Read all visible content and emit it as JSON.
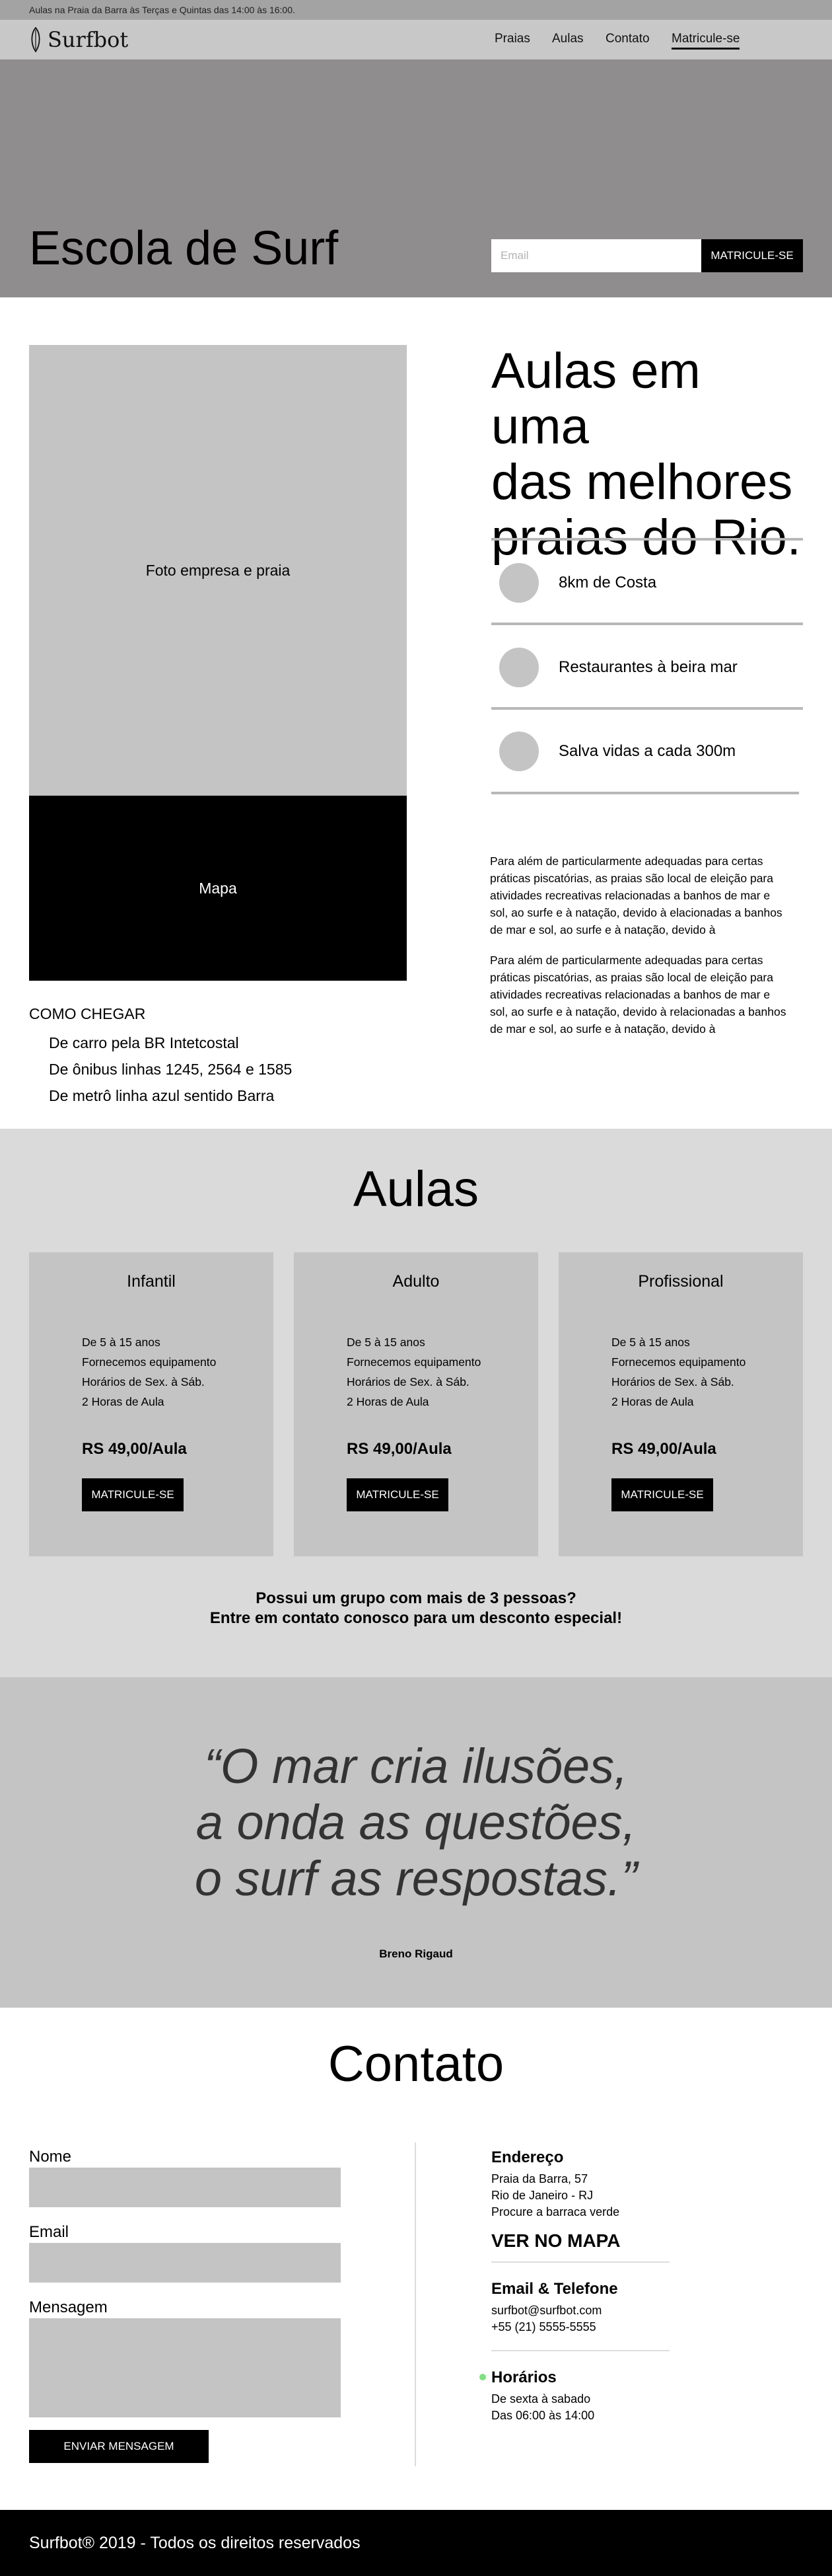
{
  "topbar": {
    "text": "Aulas na Praia da Barra às Terças e Quintas das 14:00 às 16:00."
  },
  "nav": {
    "logo": "Surfbot",
    "logo_icon": "surfboard-icon",
    "items": [
      {
        "label": "Praias"
      },
      {
        "label": "Aulas"
      },
      {
        "label": "Contato"
      },
      {
        "label": "Matricule-se",
        "active": true
      }
    ]
  },
  "hero": {
    "title": "Escola de Surf",
    "email_placeholder": "Email",
    "button": "MATRICULE-SE"
  },
  "about": {
    "photo_label": "Foto empresa e praia",
    "map_label": "Mapa",
    "how_title": "COMO CHEGAR",
    "how_items": [
      "De carro pela BR Intetcostal",
      "De ônibus linhas 1245, 2564 e 1585",
      "De metrô linha azul sentido Barra"
    ],
    "title_lines": [
      "Aulas em uma",
      "das melhores",
      "praias do Rio."
    ],
    "features": [
      {
        "label": "8km de Costa"
      },
      {
        "label": "Restaurantes à beira mar"
      },
      {
        "label": "Salva vidas a cada 300m"
      }
    ],
    "paragraph_lines": [
      "Para além de particularmente adequadas para certas",
      "práticas piscatórias, as praias são local de eleição para",
      "atividades recreativas relacionadas a banhos de mar e",
      "sol, ao surfe e à natação, devido à elacionadas a banhos",
      "de mar e sol, ao surfe e à natação, devido à"
    ],
    "paragraph2_lines": [
      "Para além de particularmente adequadas para certas",
      "práticas piscatórias, as praias são local de eleição para",
      "atividades recreativas relacionadas a banhos de mar e",
      "sol, ao surfe e à natação, devido à relacionadas a banhos",
      "de mar e sol, ao surfe e à natação, devido à"
    ]
  },
  "aulas": {
    "title": "Aulas",
    "cards": [
      {
        "title": "Infantil",
        "items": [
          "De 5 à 15 anos",
          "Fornecemos equipamento",
          "Horários de Sex. à Sáb.",
          "2 Horas de Aula"
        ],
        "price": "RS 49,00/Aula",
        "button": "MATRICULE-SE"
      },
      {
        "title": "Adulto",
        "items": [
          "De 5 à 15 anos",
          "Fornecemos equipamento",
          "Horários de Sex. à Sáb.",
          "2 Horas de Aula"
        ],
        "price": "RS 49,00/Aula",
        "button": "MATRICULE-SE"
      },
      {
        "title": "Profissional",
        "items": [
          "De 5 à 15 anos",
          "Fornecemos equipamento",
          "Horários de Sex. à Sáb.",
          "2 Horas de Aula"
        ],
        "price": "RS 49,00/Aula",
        "button": "MATRICULE-SE"
      }
    ],
    "group_line1": "Possui um grupo com mais de 3 pessoas?",
    "group_line2": "Entre em contato conosco para um desconto especial!"
  },
  "quote": {
    "lines": [
      "“O mar cria ilusões,",
      "a onda as questões,",
      "o surf as respostas.”"
    ],
    "author": "Breno Rigaud"
  },
  "contato": {
    "title": "Contato",
    "form": {
      "name_label": "Nome",
      "email_label": "Email",
      "message_label": "Mensagem",
      "submit": "ENVIAR MENSAGEM"
    },
    "address": {
      "title": "Endereço",
      "lines": [
        "Praia da Barra, 57",
        "Rio de Janeiro - RJ",
        "Procure a barraca verde"
      ],
      "map_link": "VER NO MAPA"
    },
    "phone": {
      "title": "Email & Telefone",
      "lines": [
        "surfbot@surfbot.com",
        "+55 (21) 5555-5555"
      ]
    },
    "hours": {
      "title": "Horários",
      "lines": [
        "De sexta à sabado",
        "Das 06:00 às 14:00"
      ],
      "dot_color": "#7fe07f"
    }
  },
  "footer": {
    "text": "Surfbot® 2019 - Todos os direitos reservados"
  }
}
